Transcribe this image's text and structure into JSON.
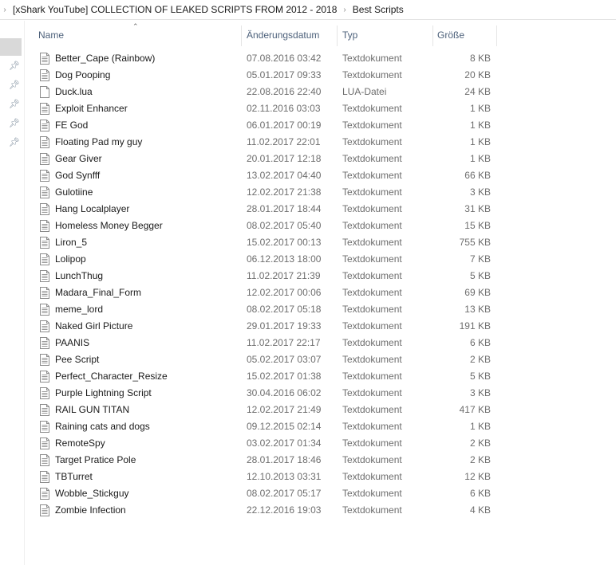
{
  "breadcrumb": {
    "items": [
      "[xShark YouTube] COLLECTION OF LEAKED SCRIPTS FROM 2012 - 2018",
      "Best Scripts"
    ]
  },
  "columns": {
    "name": "Name",
    "date": "Änderungsdatum",
    "type": "Typ",
    "size": "Größe",
    "sorted_by": "name",
    "sort_direction": "ascending"
  },
  "icons": {
    "breadcrumb_chevron": "chevron-right-icon",
    "sort": "sort-ascending-icon",
    "pin": "pin-icon",
    "text_file": "text-document-icon",
    "generic_file": "generic-file-icon"
  },
  "files": [
    {
      "name": "Better_Cape (Rainbow)",
      "date": "07.08.2016 03:42",
      "type": "Textdokument",
      "size": "8 KB",
      "icon": "text"
    },
    {
      "name": "Dog Pooping",
      "date": "05.01.2017 09:33",
      "type": "Textdokument",
      "size": "20 KB",
      "icon": "text"
    },
    {
      "name": "Duck.lua",
      "date": "22.08.2016 22:40",
      "type": "LUA-Datei",
      "size": "24 KB",
      "icon": "generic"
    },
    {
      "name": "Exploit Enhancer",
      "date": "02.11.2016 03:03",
      "type": "Textdokument",
      "size": "1 KB",
      "icon": "text"
    },
    {
      "name": "FE God",
      "date": "06.01.2017 00:19",
      "type": "Textdokument",
      "size": "1 KB",
      "icon": "text"
    },
    {
      "name": "Floating Pad my guy",
      "date": "11.02.2017 22:01",
      "type": "Textdokument",
      "size": "1 KB",
      "icon": "text"
    },
    {
      "name": "Gear Giver",
      "date": "20.01.2017 12:18",
      "type": "Textdokument",
      "size": "1 KB",
      "icon": "text"
    },
    {
      "name": "God Synfff",
      "date": "13.02.2017 04:40",
      "type": "Textdokument",
      "size": "66 KB",
      "icon": "text"
    },
    {
      "name": "Gulotiine",
      "date": "12.02.2017 21:38",
      "type": "Textdokument",
      "size": "3 KB",
      "icon": "text"
    },
    {
      "name": "Hang Localplayer",
      "date": "28.01.2017 18:44",
      "type": "Textdokument",
      "size": "31 KB",
      "icon": "text"
    },
    {
      "name": "Homeless Money Begger",
      "date": "08.02.2017 05:40",
      "type": "Textdokument",
      "size": "15 KB",
      "icon": "text"
    },
    {
      "name": "Liron_5",
      "date": "15.02.2017 00:13",
      "type": "Textdokument",
      "size": "755 KB",
      "icon": "text"
    },
    {
      "name": "Lolipop",
      "date": "06.12.2013 18:00",
      "type": "Textdokument",
      "size": "7 KB",
      "icon": "text"
    },
    {
      "name": "LunchThug",
      "date": "11.02.2017 21:39",
      "type": "Textdokument",
      "size": "5 KB",
      "icon": "text"
    },
    {
      "name": "Madara_Final_Form",
      "date": "12.02.2017 00:06",
      "type": "Textdokument",
      "size": "69 KB",
      "icon": "text"
    },
    {
      "name": "meme_lord",
      "date": "08.02.2017 05:18",
      "type": "Textdokument",
      "size": "13 KB",
      "icon": "text"
    },
    {
      "name": "Naked Girl Picture",
      "date": "29.01.2017 19:33",
      "type": "Textdokument",
      "size": "191 KB",
      "icon": "text"
    },
    {
      "name": "PAANIS",
      "date": "11.02.2017 22:17",
      "type": "Textdokument",
      "size": "6 KB",
      "icon": "text"
    },
    {
      "name": "Pee Script",
      "date": "05.02.2017 03:07",
      "type": "Textdokument",
      "size": "2 KB",
      "icon": "text"
    },
    {
      "name": "Perfect_Character_Resize",
      "date": "15.02.2017 01:38",
      "type": "Textdokument",
      "size": "5 KB",
      "icon": "text"
    },
    {
      "name": "Purple Lightning Script",
      "date": "30.04.2016 06:02",
      "type": "Textdokument",
      "size": "3 KB",
      "icon": "text"
    },
    {
      "name": "RAIL GUN TITAN",
      "date": "12.02.2017 21:49",
      "type": "Textdokument",
      "size": "417 KB",
      "icon": "text"
    },
    {
      "name": "Raining cats and dogs",
      "date": "09.12.2015 02:14",
      "type": "Textdokument",
      "size": "1 KB",
      "icon": "text"
    },
    {
      "name": "RemoteSpy",
      "date": "03.02.2017 01:34",
      "type": "Textdokument",
      "size": "2 KB",
      "icon": "text"
    },
    {
      "name": "Target Pratice Pole",
      "date": "28.01.2017 18:46",
      "type": "Textdokument",
      "size": "2 KB",
      "icon": "text"
    },
    {
      "name": "TBTurret",
      "date": "12.10.2013 03:31",
      "type": "Textdokument",
      "size": "12 KB",
      "icon": "text"
    },
    {
      "name": "Wobble_Stickguy",
      "date": "08.02.2017 05:17",
      "type": "Textdokument",
      "size": "6 KB",
      "icon": "text"
    },
    {
      "name": "Zombie Infection",
      "date": "22.12.2016 19:03",
      "type": "Textdokument",
      "size": "4 KB",
      "icon": "text"
    }
  ],
  "nav_pane": {
    "pinned_count": 5
  },
  "colors": {
    "header_text": "#4c607a",
    "secondary_text": "#6d6d6d",
    "nav_selected": "#d9d9d9"
  }
}
